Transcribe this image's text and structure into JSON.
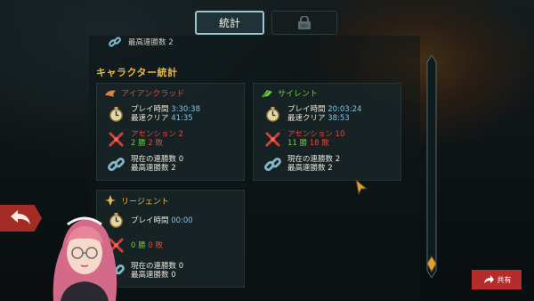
{
  "tabs": {
    "stats_label": "統計"
  },
  "prev_item": {
    "label": "最高連勝数 2"
  },
  "section_title": "キャラクター統計",
  "characters": [
    {
      "name": "アイアンクラッド",
      "name_color": "#e2493f",
      "icon": "ironclad-icon",
      "playtime_label": "プレイ時間",
      "playtime": "3:30:38",
      "fastest_label": "最速クリア",
      "fastest": "41:35",
      "ascension_label": "アセンション 2",
      "wins_label": "2 勝",
      "losses_label": "2 敗",
      "streak_label": "現在の連勝数 0",
      "best_streak_label": "最高連勝数 2"
    },
    {
      "name": "サイレント",
      "name_color": "#6ccd3d",
      "icon": "silent-icon",
      "playtime_label": "プレイ時間",
      "playtime": "20:03:24",
      "fastest_label": "最速クリア",
      "fastest": "38:53",
      "ascension_label": "アセンション 10",
      "wins_label": "11 勝",
      "losses_label": "18 敗",
      "streak_label": "現在の連勝数 2",
      "best_streak_label": "最高連勝数 2"
    },
    {
      "name": "リージェント",
      "name_color": "#e9b84a",
      "icon": "regent-icon",
      "playtime_label": "プレイ時間",
      "playtime": "00:00",
      "wins_label": "0 勝",
      "losses_label": "0 敗",
      "streak_label": "現在の連勝数 0",
      "best_streak_label": "最高連勝数 0"
    }
  ],
  "share": {
    "label": "共有"
  },
  "icons": [
    "stopwatch-icon",
    "crossed-swords-icon",
    "chain-link-icon",
    "lock-icon",
    "back-arrow-icon",
    "share-arrow-icon",
    "mouse-cursor-icon",
    "avatar-streamer"
  ]
}
